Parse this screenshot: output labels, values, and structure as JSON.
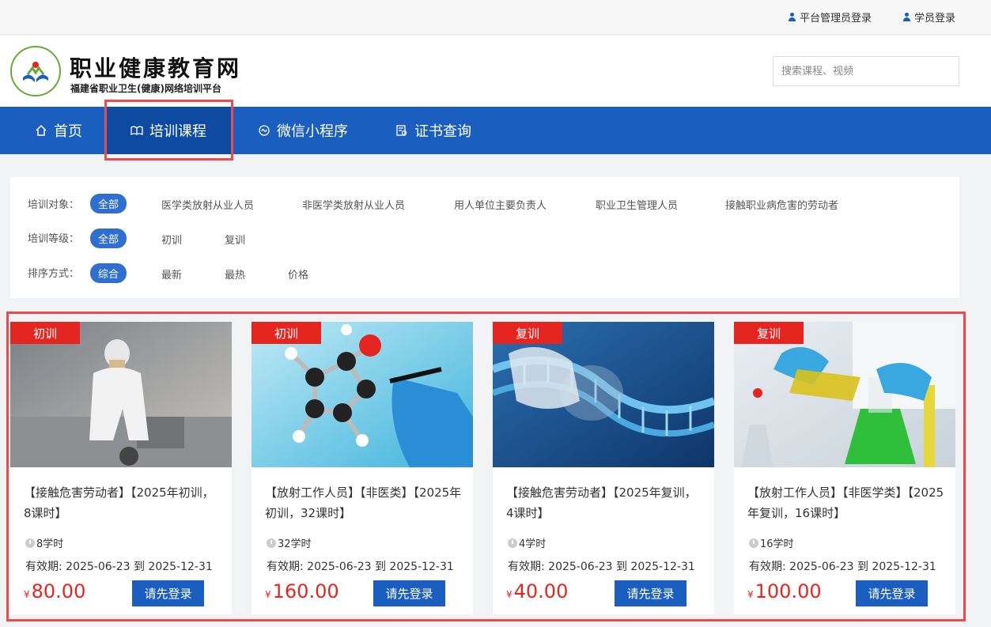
{
  "topbar": {
    "admin_login": "平台管理员登录",
    "student_login": "学员登录"
  },
  "header": {
    "title": "职业健康教育网",
    "subtitle": "福建省职业卫生(健康)网络培训平台",
    "search_placeholder": "搜索课程、视频"
  },
  "nav": {
    "items": [
      {
        "label": "首页"
      },
      {
        "label": "培训课程"
      },
      {
        "label": "微信小程序"
      },
      {
        "label": "证书查询"
      }
    ]
  },
  "filters": {
    "target": {
      "label": "培训对象：",
      "options": [
        "全部",
        "医学类放射从业人员",
        "非医学类放射从业人员",
        "用人单位主要负责人",
        "职业卫生管理人员",
        "接触职业病危害的劳动者"
      ]
    },
    "level": {
      "label": "培训等级：",
      "options": [
        "全部",
        "初训",
        "复训"
      ]
    },
    "sort": {
      "label": "排序方式：",
      "options": [
        "综合",
        "最新",
        "最热",
        "价格"
      ]
    }
  },
  "courses": [
    {
      "badge": "初训",
      "title": "【接触危害劳动者】【2025年初训，8课时】",
      "hours": "8学时",
      "validity": "有效期: 2025-06-23 到 2025-12-31",
      "currency": "¥",
      "price": "80.00",
      "button": "请先登录"
    },
    {
      "badge": "初训",
      "title": "【放射工作人员】【非医类】【2025年初训，32课时】",
      "hours": "32学时",
      "validity": "有效期: 2025-06-23 到 2025-12-31",
      "currency": "¥",
      "price": "160.00",
      "button": "请先登录"
    },
    {
      "badge": "复训",
      "title": "【接触危害劳动者】【2025年复训，4课时】",
      "hours": "4学时",
      "validity": "有效期: 2025-06-23 到 2025-12-31",
      "currency": "¥",
      "price": "40.00",
      "button": "请先登录"
    },
    {
      "badge": "复训",
      "title": "【放射工作人员】【非医学类】【2025年复训，16课时】",
      "hours": "16学时",
      "validity": "有效期: 2025-06-23 到 2025-12-31",
      "currency": "¥",
      "price": "100.00",
      "button": "请先登录"
    }
  ],
  "colors": {
    "brand_blue": "#1a5fbf",
    "badge_red": "#e52620",
    "highlight_red": "#e84c4c"
  }
}
